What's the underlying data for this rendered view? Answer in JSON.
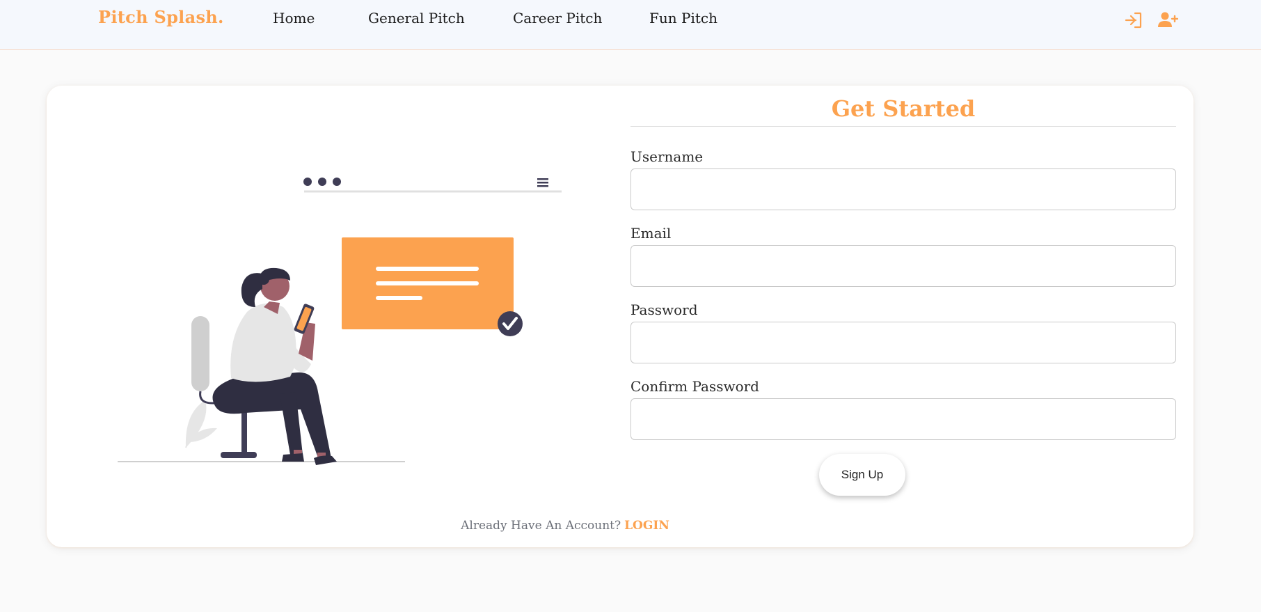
{
  "navbar": {
    "brand": "Pitch Splash.",
    "links": [
      "Home",
      "General Pitch",
      "Career Pitch",
      "Fun Pitch"
    ],
    "icons": [
      "login-icon",
      "user-plus-icon"
    ]
  },
  "form": {
    "title": "Get Started",
    "fields": [
      {
        "label": "Username",
        "value": ""
      },
      {
        "label": "Email",
        "value": ""
      },
      {
        "label": "Password",
        "value": ""
      },
      {
        "label": "Confirm Password",
        "value": ""
      }
    ],
    "submit_label": "Sign Up"
  },
  "footer": {
    "prompt": "Already Have An Account?",
    "login_label": "LOGIN"
  },
  "colors": {
    "accent": "#fca24f",
    "navbar_bg": "#f5f8fd",
    "page_bg": "#fafafa",
    "illustration_dark": "#3f3d56"
  }
}
